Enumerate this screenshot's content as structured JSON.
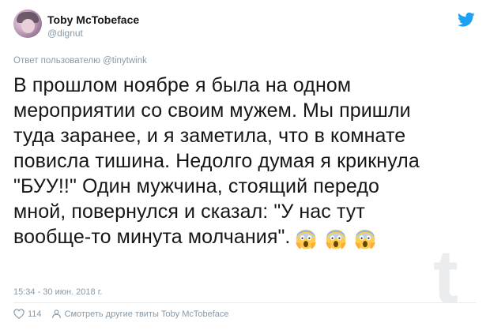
{
  "author": {
    "name": "Toby McTobeface",
    "handle": "@dignut"
  },
  "reply": {
    "prefix": "Ответ пользователю",
    "mention": "@tinytwink"
  },
  "tweet": {
    "lines": [
      "В прошлом ноябре я была на одном",
      "мероприятии со своим мужем. Мы пришли",
      "туда заранее, и я заметила, что в комнате",
      "повисла тишина. Недолго думая я крикнула",
      "\"БУУ!!\" Один мужчина, стоящий передо",
      "мной, повернулся и сказал: \"У нас тут",
      "вообще-то минута молчания\"."
    ],
    "emoji": [
      "face-screaming-in-fear",
      "face-screaming-in-fear",
      "face-screaming-in-fear"
    ]
  },
  "timestamp": "15:34 - 30 июн. 2018 г.",
  "footer": {
    "likes": "114",
    "more_tweets": "Смотреть другие твиты Toby McTobeface"
  },
  "icons": {
    "twitter": "twitter-bird-icon",
    "like": "heart-icon",
    "profile": "person-icon"
  },
  "colors": {
    "accent": "#1da1f2",
    "muted": "#8899a6",
    "text": "#14171a"
  }
}
